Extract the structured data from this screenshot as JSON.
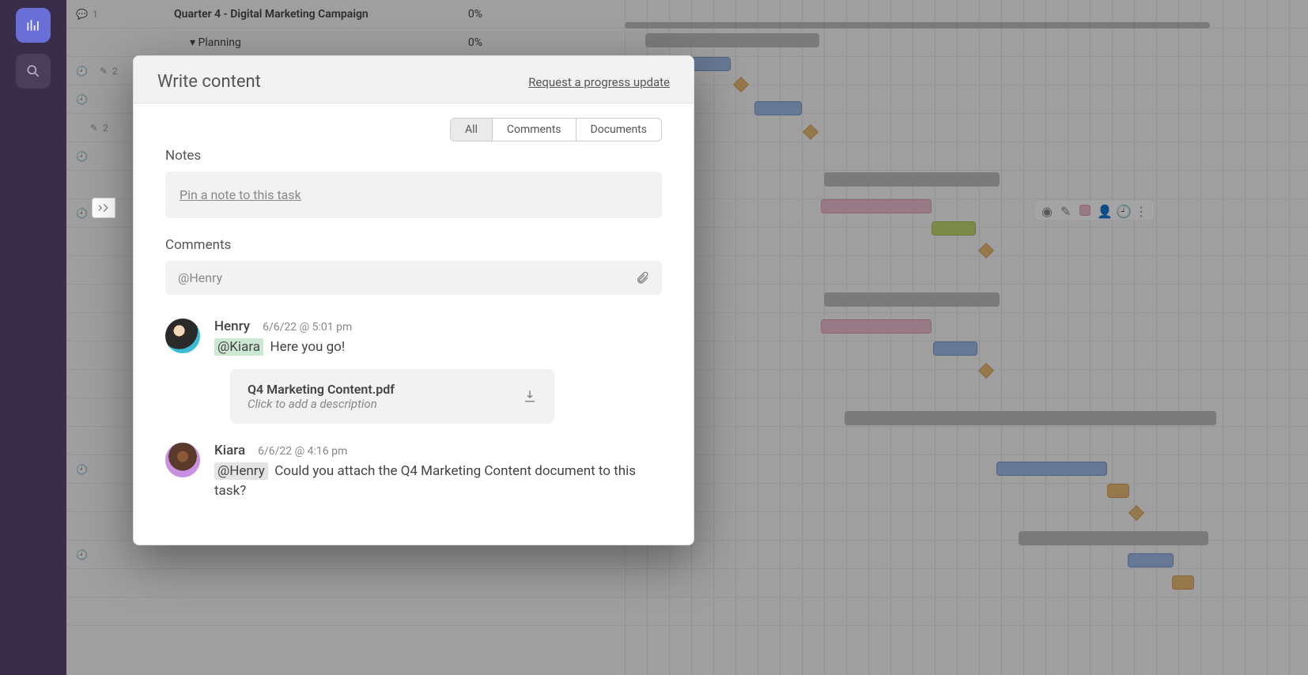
{
  "rows": [
    {
      "name": "Quarter 4 - Digital Marketing Campaign",
      "pct": "0%",
      "level": 0,
      "badge": "1",
      "badgeType": "comment"
    },
    {
      "name": "Planning",
      "pct": "0%",
      "level": 1,
      "expand": true
    },
    {
      "name": "",
      "pct": "",
      "badge": "2",
      "badgeType": "edit",
      "clock": true
    },
    {
      "name": "",
      "pct": "",
      "clock": true
    },
    {
      "name": "",
      "pct": "",
      "badge": "2",
      "badgeType": "edit"
    },
    {
      "name": "",
      "pct": "",
      "clock": true
    },
    {
      "name": "",
      "pct": ""
    },
    {
      "name": "",
      "pct": ""
    },
    {
      "name": "",
      "pct": "",
      "clock": true,
      "editBadge": true
    }
  ],
  "modal": {
    "title": "Write content",
    "progress_link": "Request a progress update",
    "tabs": {
      "all": "All",
      "comments": "Comments",
      "documents": "Documents"
    },
    "notes_label": "Notes",
    "pin_note": "Pin a note to this task",
    "comments_label": "Comments",
    "comment_placeholder": "@Henry",
    "thread": [
      {
        "name": "Henry",
        "time": "6/6/22 @ 5:01 pm",
        "mention": "@Kiara",
        "mention_style": "green",
        "text": "Here you go!",
        "file": {
          "name": "Q4 Marketing Content.pdf",
          "desc": "Click to add a description"
        }
      },
      {
        "name": "Kiara",
        "time": "6/6/22 @ 4:16 pm",
        "mention": "@Henry",
        "mention_style": "gray",
        "text": "Could you attach the Q4 Marketing Content document to this task?"
      }
    ]
  }
}
